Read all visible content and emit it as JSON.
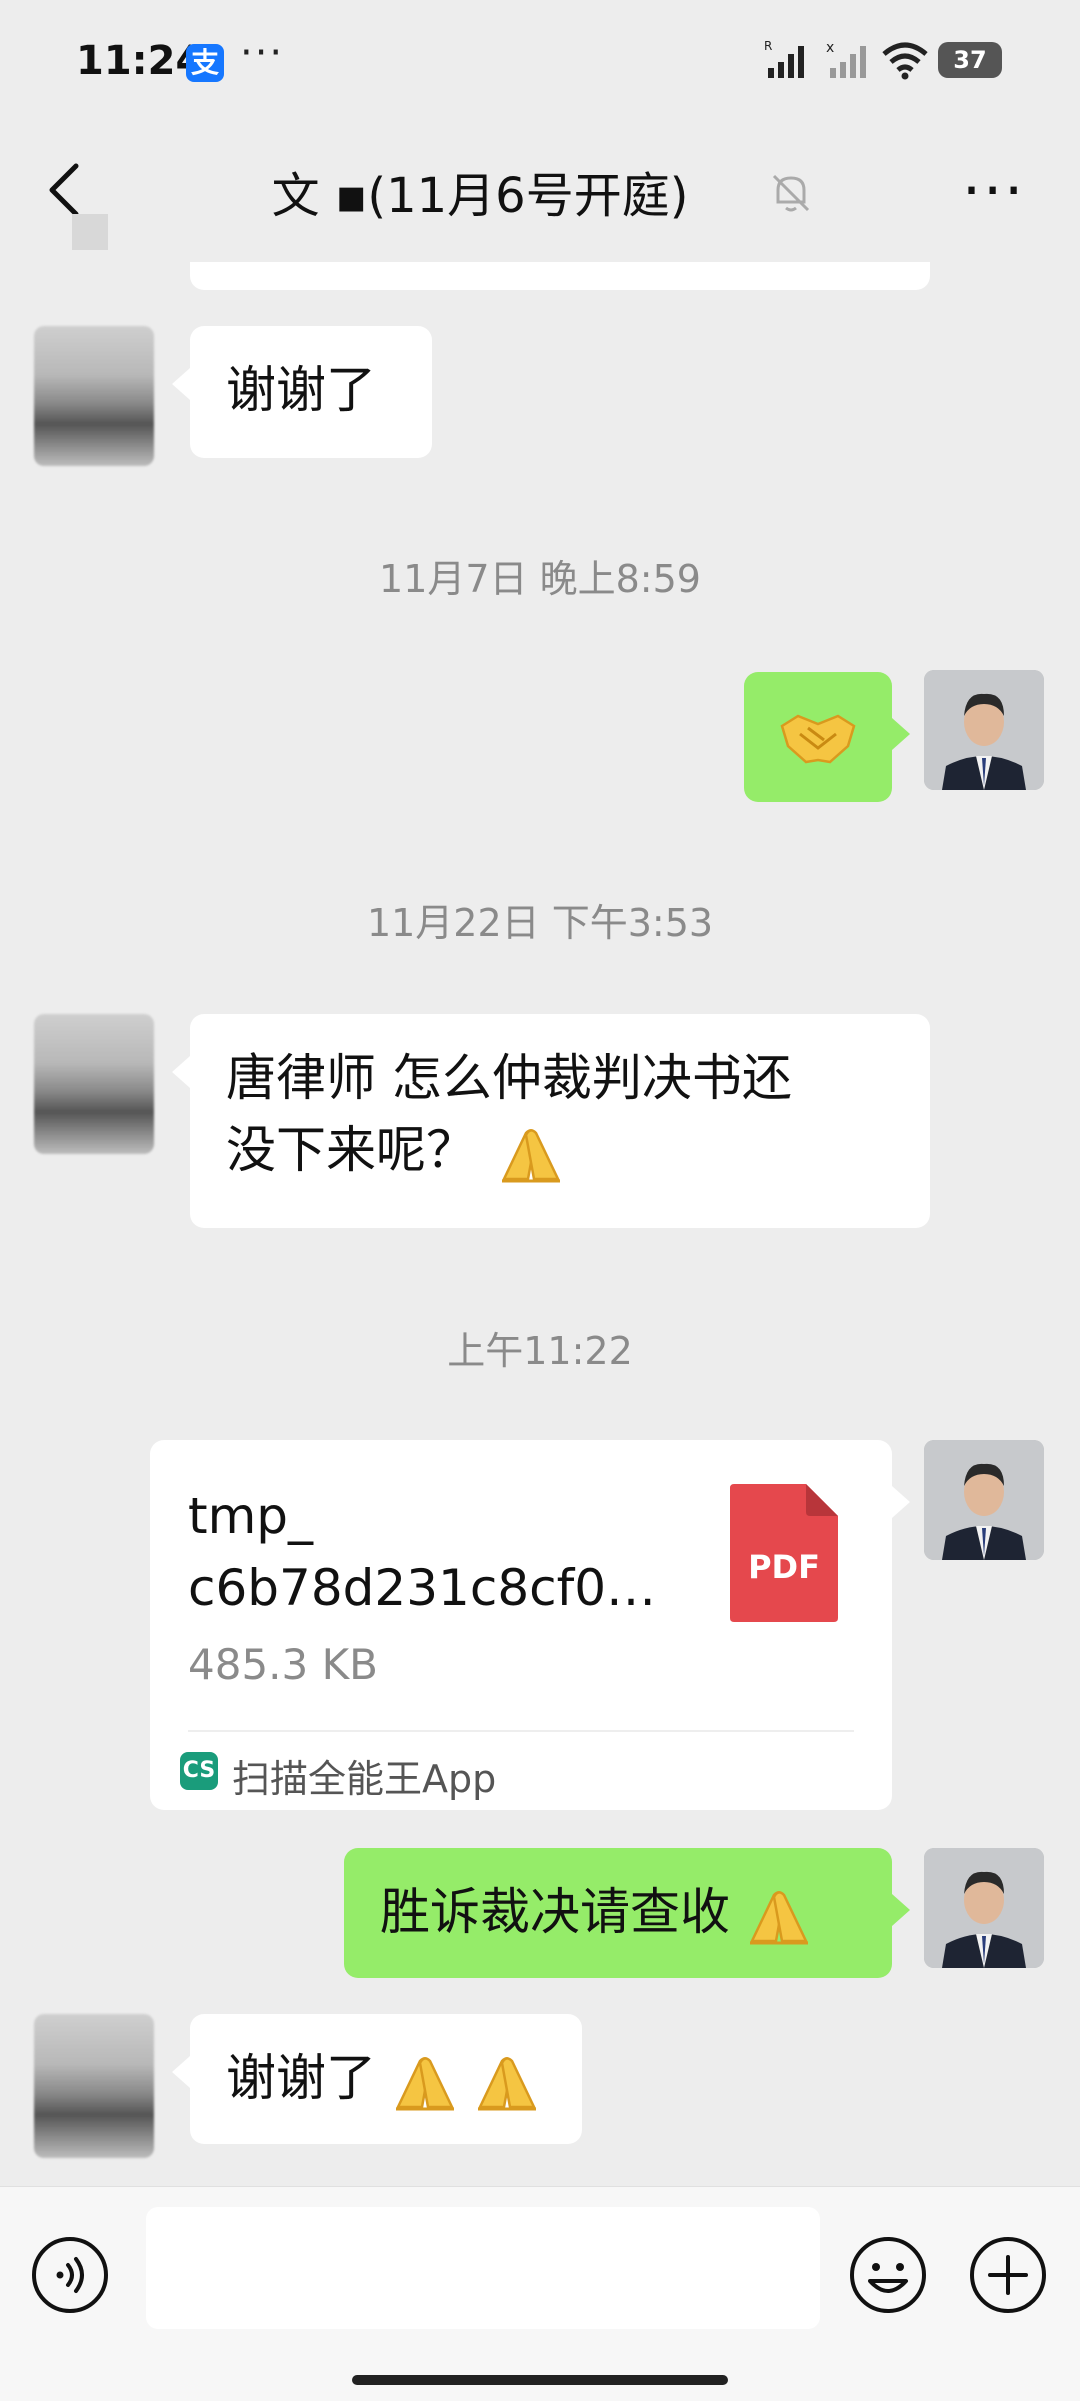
{
  "status_bar": {
    "time": "11:24",
    "alipay_label": "支",
    "dots": "···",
    "battery": "37",
    "signal_label_1": "R",
    "signal_label_2": "x"
  },
  "header": {
    "title": "文 ▪(11月6号开庭)",
    "more_label": "···"
  },
  "messages": [
    {
      "side": "left",
      "text": "谢谢了"
    },
    {
      "timestamp": "11月7日 晚上8:59"
    },
    {
      "side": "right",
      "emoji": "handshake"
    },
    {
      "timestamp": "11月22日 下午3:53"
    },
    {
      "side": "left",
      "text_line1": "唐律师  怎么仲裁判决书还",
      "text_line2": "没下来呢？"
    },
    {
      "timestamp": "上午11:22"
    },
    {
      "side": "right",
      "type": "file"
    },
    {
      "side": "right",
      "text": "胜诉裁决请查收"
    },
    {
      "side": "left",
      "text": "谢谢了"
    }
  ],
  "timestamps": {
    "t1": "11月7日 晚上8:59",
    "t2": "11月22日 下午3:53",
    "t3": "上午11:22"
  },
  "msg1": {
    "text": "谢谢了"
  },
  "msg4": {
    "line1": "唐律师  怎么仲裁判决书还",
    "line2": "没下来呢？"
  },
  "file": {
    "name": "tmp_\nc6b78d231c8cf0…",
    "name_line1": "tmp_",
    "name_line2": "c6b78d231c8cf0…",
    "size": "485.3 KB",
    "source_icon": "CS",
    "source": "扫描全能王App",
    "type_label": "PDF"
  },
  "msg6": {
    "text": "胜诉裁决请查收"
  },
  "msg7": {
    "text": "谢谢了"
  },
  "bottom": {
    "input_value": ""
  },
  "colors": {
    "background": "#ededed",
    "bubble_self": "#95ec69",
    "bubble_other": "#ffffff",
    "pdf_red": "#e5484d",
    "alipay_blue": "#1677ff"
  },
  "icons": [
    "back-icon",
    "mute-bell-icon",
    "more-icon",
    "handshake-emoji",
    "folded-hands-emoji",
    "pdf-icon",
    "voice-icon",
    "emoji-icon",
    "plus-icon"
  ]
}
